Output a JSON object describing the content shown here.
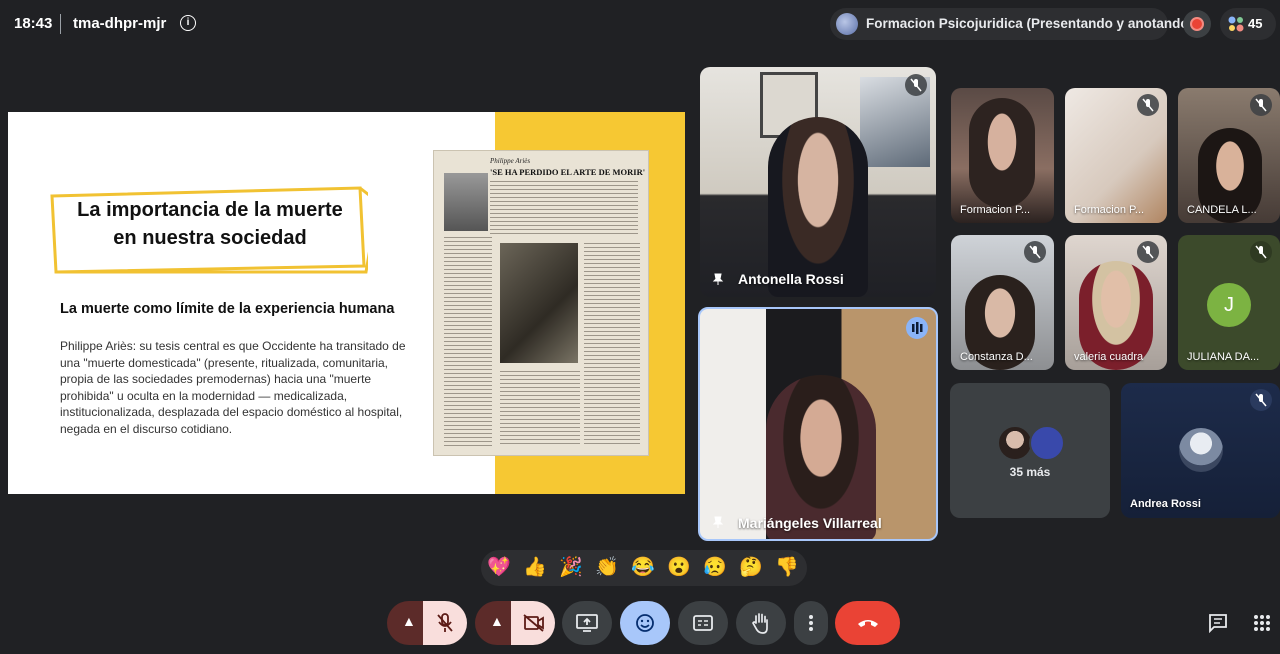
{
  "topbar": {
    "time": "18:43",
    "meeting_code": "tma-dhpr-mjr",
    "presenter": "Formacion Psicojuridica (Presentando y anotando)",
    "participant_count": "45"
  },
  "slide": {
    "title_line1": "La importancia de la muerte",
    "title_line2": "en nuestra sociedad",
    "subtitle": "La muerte como límite de la experiencia humana",
    "body": "Philippe Ariès: su tesis central es que Occidente ha transitado de una \"muerte domesticada\" (presente, ritualizada, comunitaria, propia de las sociedades premodernas) hacia una \"muerte prohibida\" u oculta en la modernidad — medicalizada, institucionalizada, desplazada del espacio doméstico al hospital, negada en el discurso cotidiano.",
    "clipping_author": "Philippe Ariès",
    "clipping_headline": "'SE HA PERDIDO EL ARTE DE MORIR'"
  },
  "participants": {
    "antonella": "Antonella Rossi",
    "mariangeles": "Mariángeles Villarreal",
    "formacion1": "Formacion P...",
    "formacion2": "Formacion P...",
    "candela": "CANDELA L...",
    "constanza": "Constanza D...",
    "valeria": "valeria cuadra",
    "juliana": "JULIANA DA...",
    "juliana_initial": "J",
    "more": "35 más",
    "andrea": "Andrea Rossi"
  },
  "reactions": [
    "💖",
    "👍",
    "🎉",
    "👏",
    "😂",
    "😮",
    "😥",
    "🤔",
    "👎"
  ],
  "colors": {
    "hangup": "#ea4335",
    "mute_bg": "#f9dedc",
    "emoji_active": "#a8c7fa",
    "speaking": "#8ab4f8"
  }
}
